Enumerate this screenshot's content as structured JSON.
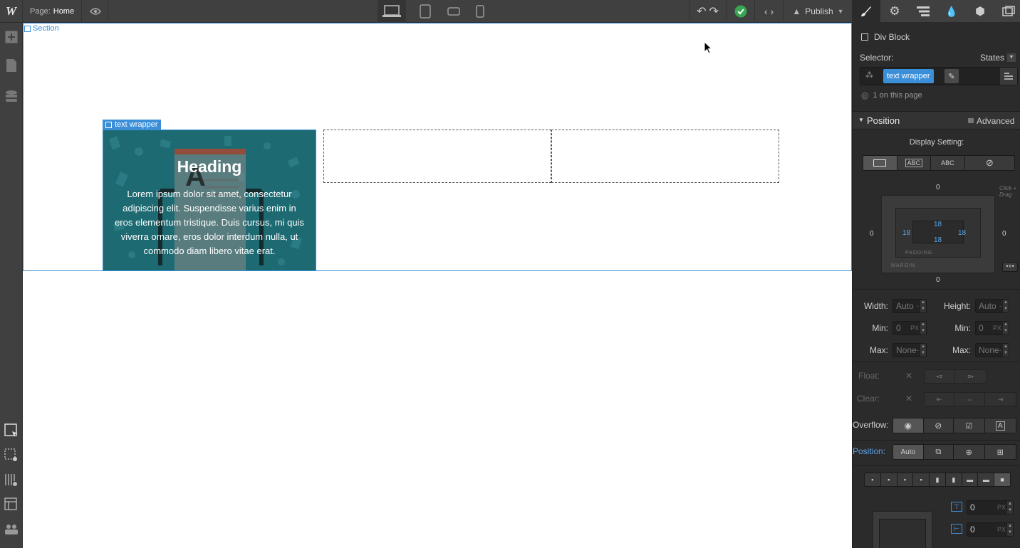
{
  "topbar": {
    "page_label": "Page:",
    "page_value": "Home",
    "publish_label": "Publish"
  },
  "canvas": {
    "section_label": "Section",
    "text_wrapper_label": "text wrapper",
    "card": {
      "heading": "Heading",
      "body": "Lorem ipsum dolor sit amet, consectetur adipiscing elit. Suspendisse varius enim in eros elementum tristique. Duis cursus, mi quis viverra ornare, eros dolor interdum nulla, ut commodo diam libero vitae erat."
    }
  },
  "panel": {
    "element_type": "Div Block",
    "selector_label": "Selector:",
    "states_label": "States",
    "selector_tag": "text wrapper",
    "on_page": "1 on this page",
    "section_title": "Position",
    "advanced_label": "Advanced",
    "display_setting_label": "Display Setting:",
    "display_options": [
      "ABC",
      "ABC"
    ],
    "box_model": {
      "margin_top": "0",
      "margin_bottom": "0",
      "margin_left": "0",
      "margin_right": "0",
      "padding_top": "18",
      "padding_bottom": "18",
      "padding_left": "18",
      "padding_right": "18",
      "padding_label": "PADDING",
      "margin_label": "MARGIN",
      "hint": "Click + Drag"
    },
    "size": {
      "width_label": "Width:",
      "width_value": "Auto",
      "height_label": "Height:",
      "height_value": "Auto",
      "min_label": "Min:",
      "min_w": "0",
      "min_h": "0",
      "unit": "PX",
      "max_label": "Max:",
      "max_w": "None",
      "max_h": "None"
    },
    "float_label": "Float:",
    "clear_label": "Clear:",
    "overflow_label": "Overflow:",
    "position_label": "Position:",
    "position_auto": "Auto",
    "offset_top": "0",
    "offset_left": "0",
    "offset_unit": "PX"
  },
  "colors": {
    "accent": "#3b8fd9",
    "card_bg": "#1d6a72",
    "success": "#3aa551"
  }
}
